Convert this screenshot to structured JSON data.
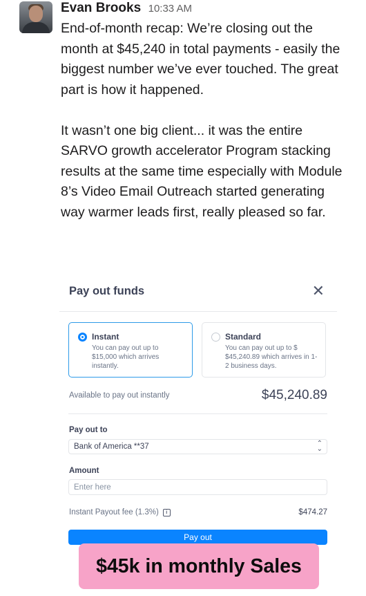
{
  "message": {
    "sender": "Evan Brooks",
    "time": "10:33 AM",
    "paragraphs": [
      "End-of-month recap: We’re closing out the month at $45,240 in total payments - easily the biggest number we’ve ever touched. The great part is how it happened.",
      "It wasn’t one big client... it was the entire SARVO growth accelerator Program stacking results at the same time especially with Module 8’s Video Email Outreach started generating way warmer leads first, really pleased so far."
    ]
  },
  "payout": {
    "title": "Pay out funds",
    "close_icon": "close-icon",
    "options": [
      {
        "label": "Instant",
        "description": "You can pay out up to $15,000 which arrives instantly.",
        "selected": true
      },
      {
        "label": "Standard",
        "description": "You can pay out up to $ $45,240.89 which arrives in 1-2 business days.",
        "selected": false
      }
    ],
    "available_label": "Available to pay out instantly",
    "available_value": "$45,240.89",
    "pay_out_to_label": "Pay out to",
    "bank_selected": "Bank of America **37",
    "amount_label": "Amount",
    "amount_placeholder": "Enter here",
    "fee_label": "Instant Payout fee (1.3%)",
    "fee_icon": "info-icon",
    "fee_value": "$474.27",
    "button_label": "Pay out",
    "accent_color": "#0a84ff"
  },
  "banner": {
    "text": "$45k in monthly Sales",
    "color": "#f7a3c8"
  }
}
